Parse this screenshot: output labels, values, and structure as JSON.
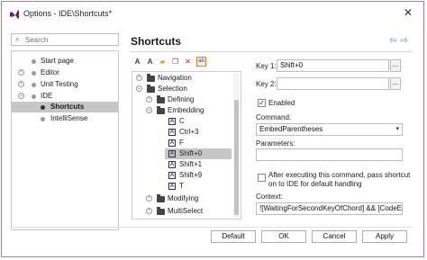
{
  "window": {
    "title": "Options - IDE\\Shortcuts*"
  },
  "search": {
    "placeholder": "Search"
  },
  "nav_tree": [
    {
      "label": "Start page"
    },
    {
      "label": "Editor"
    },
    {
      "label": "Unit Testing"
    },
    {
      "label": "IDE"
    },
    {
      "label": "Shortcuts"
    },
    {
      "label": "IntelliSense"
    }
  ],
  "header": {
    "title": "Shortcuts"
  },
  "command_tree": [
    {
      "label": "Navigation"
    },
    {
      "label": "Selection"
    },
    {
      "label": "Defining"
    },
    {
      "label": "Embedding"
    },
    {
      "label": "C"
    },
    {
      "label": "Ctrl+3"
    },
    {
      "label": "F"
    },
    {
      "label": "Shift+0"
    },
    {
      "label": "Shift+1"
    },
    {
      "label": "Shift+9"
    },
    {
      "label": "T"
    },
    {
      "label": "Modifying"
    },
    {
      "label": "MultiSelect"
    }
  ],
  "form": {
    "key1_label": "Key 1:",
    "key1_value": "Shift+0",
    "key2_label": "Key 2:",
    "key2_value": "",
    "enabled_label": "Enabled",
    "enabled_checked": true,
    "command_label": "Command:",
    "command_value": "EmbedParentheses",
    "parameters_label": "Parameters:",
    "parameters_value": "",
    "pass_label_line1": "After executing this command, pass shortcut",
    "pass_label_line2": "on to IDE for default handling",
    "pass_checked": false,
    "context_label": "Context:",
    "context_value": "![WaitingForSecondKeyOfChord] && [CodeEdit"
  },
  "buttons": {
    "default": "Default",
    "ok": "OK",
    "cancel": "Cancel",
    "apply": "Apply"
  },
  "colors": {
    "accent": "#4a8dd8",
    "highlight": "#e87d1e",
    "selection": "#c6c6c6",
    "vs_purple": "#68217a"
  },
  "icons": [
    "vs-logo-icon",
    "close-icon",
    "search-icon",
    "back-arrow-icon",
    "forward-arrow-icon",
    "folder-icon",
    "key-icon"
  ]
}
